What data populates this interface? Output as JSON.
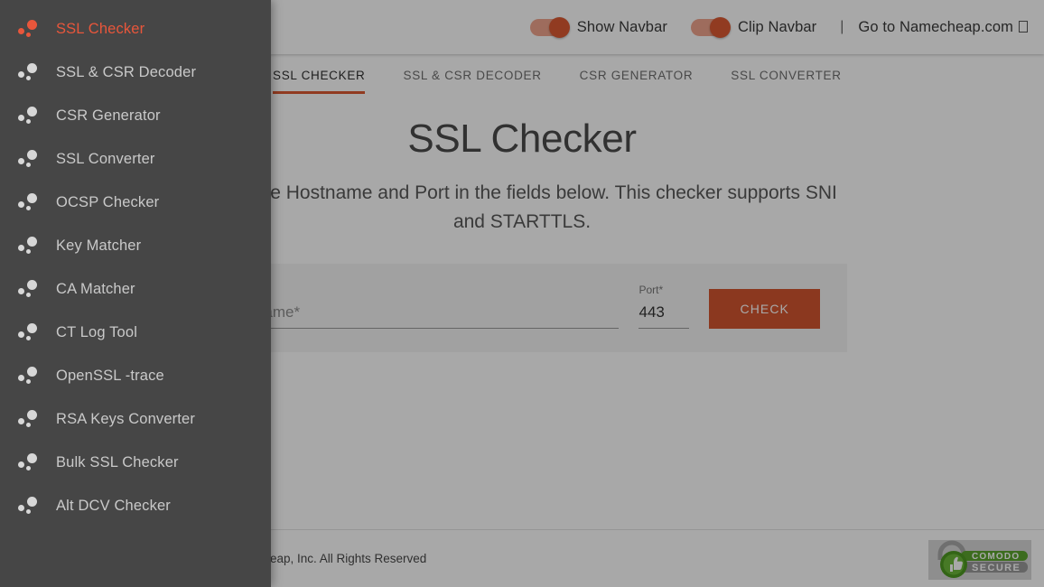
{
  "sidebar": {
    "items": [
      {
        "label": "SSL Checker",
        "active": true,
        "icon": "dots-cluster-icon"
      },
      {
        "label": "SSL & CSR Decoder",
        "active": false,
        "icon": "dots-cluster-icon"
      },
      {
        "label": "CSR Generator",
        "active": false,
        "icon": "dots-cluster-icon"
      },
      {
        "label": "SSL Converter",
        "active": false,
        "icon": "dots-cluster-icon"
      },
      {
        "label": "OCSP Checker",
        "active": false,
        "icon": "dots-cluster-icon"
      },
      {
        "label": "Key Matcher",
        "active": false,
        "icon": "dots-cluster-icon"
      },
      {
        "label": "CA Matcher",
        "active": false,
        "icon": "dots-cluster-icon"
      },
      {
        "label": "CT Log Tool",
        "active": false,
        "icon": "dots-cluster-icon"
      },
      {
        "label": "OpenSSL -trace",
        "active": false,
        "icon": "dots-cluster-icon"
      },
      {
        "label": "RSA Keys Converter",
        "active": false,
        "icon": "dots-cluster-icon"
      },
      {
        "label": "Bulk SSL Checker",
        "active": false,
        "icon": "dots-cluster-icon"
      },
      {
        "label": "Alt DCV Checker",
        "active": false,
        "icon": "dots-cluster-icon"
      }
    ]
  },
  "topbar": {
    "show_navbar_label": "Show Navbar",
    "show_navbar_state": "on",
    "clip_navbar_label": "Clip Navbar",
    "clip_navbar_state": "on",
    "separator": "|",
    "external_link_label": "Go to Namecheap.com",
    "external_link_icon": "external-link-icon"
  },
  "tabs": [
    {
      "label": "SSL CHECKER",
      "active": true
    },
    {
      "label": "SSL & CSR DECODER",
      "active": false
    },
    {
      "label": "CSR GENERATOR",
      "active": false
    },
    {
      "label": "SSL CONVERTER",
      "active": false
    }
  ],
  "main": {
    "title": "SSL Checker",
    "description": "Input the Hostname and Port in the fields below. This checker supports SNI and STARTTLS.",
    "form": {
      "hostname_label": "Hostname*",
      "hostname_value": "",
      "hostname_placeholder": "Hostname*",
      "port_label": "Port*",
      "port_value": "443",
      "submit_label": "CHECK"
    }
  },
  "footer": {
    "copyright": "© Namecheap, Inc. All Rights Reserved",
    "badge": {
      "top_text": "COMODO",
      "bottom_text": "SECURE",
      "icon": "padlock-thumbs-up-icon"
    }
  },
  "colors": {
    "accent": "#dd5a33",
    "sidebar_bg": "#464646",
    "active_nav": "#e8563b",
    "badge_green": "#5ba52e"
  }
}
